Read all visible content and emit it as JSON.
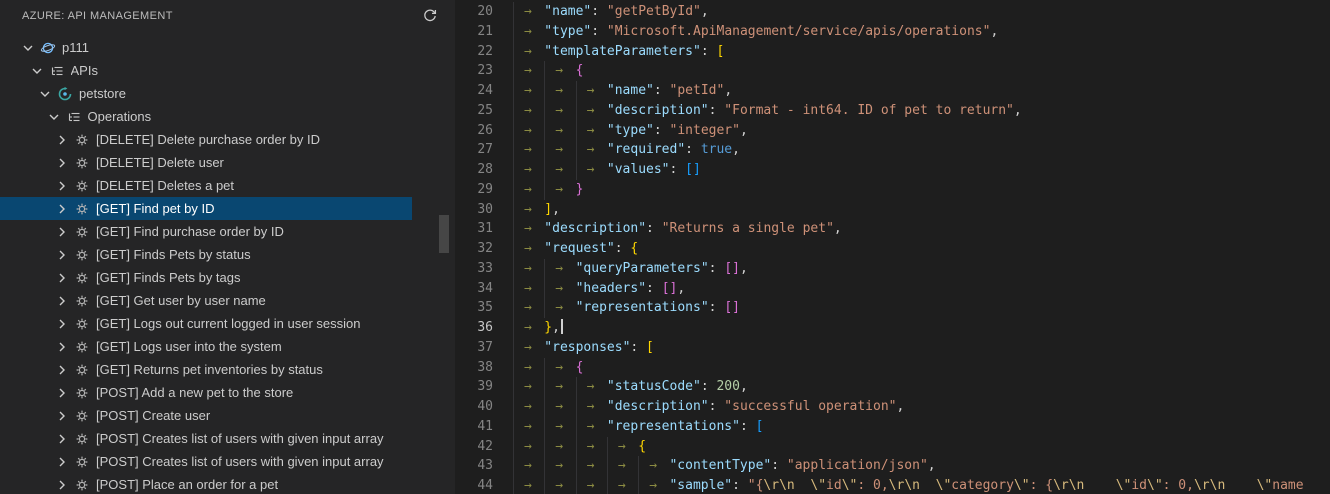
{
  "sidebar": {
    "title": "AZURE: API MANAGEMENT",
    "tree": [
      {
        "label": "p111",
        "level": 0,
        "expanded": true,
        "icon": "apim-service",
        "selected": false
      },
      {
        "label": "APIs",
        "level": 1,
        "expanded": true,
        "icon": "list-tree",
        "selected": false
      },
      {
        "label": "petstore",
        "level": 2,
        "expanded": true,
        "icon": "api",
        "selected": false
      },
      {
        "label": "Operations",
        "level": 3,
        "expanded": true,
        "icon": "list-tree",
        "selected": false
      },
      {
        "label": "[DELETE] Delete purchase order by ID",
        "level": 4,
        "expanded": false,
        "icon": "operation",
        "selected": false
      },
      {
        "label": "[DELETE] Delete user",
        "level": 4,
        "expanded": false,
        "icon": "operation",
        "selected": false
      },
      {
        "label": "[DELETE] Deletes a pet",
        "level": 4,
        "expanded": false,
        "icon": "operation",
        "selected": false
      },
      {
        "label": "[GET] Find pet by ID",
        "level": 4,
        "expanded": false,
        "icon": "operation",
        "selected": true
      },
      {
        "label": "[GET] Find purchase order by ID",
        "level": 4,
        "expanded": false,
        "icon": "operation",
        "selected": false
      },
      {
        "label": "[GET] Finds Pets by status",
        "level": 4,
        "expanded": false,
        "icon": "operation",
        "selected": false
      },
      {
        "label": "[GET] Finds Pets by tags",
        "level": 4,
        "expanded": false,
        "icon": "operation",
        "selected": false
      },
      {
        "label": "[GET] Get user by user name",
        "level": 4,
        "expanded": false,
        "icon": "operation",
        "selected": false
      },
      {
        "label": "[GET] Logs out current logged in user session",
        "level": 4,
        "expanded": false,
        "icon": "operation",
        "selected": false
      },
      {
        "label": "[GET] Logs user into the system",
        "level": 4,
        "expanded": false,
        "icon": "operation",
        "selected": false
      },
      {
        "label": "[GET] Returns pet inventories by status",
        "level": 4,
        "expanded": false,
        "icon": "operation",
        "selected": false
      },
      {
        "label": "[POST] Add a new pet to the store",
        "level": 4,
        "expanded": false,
        "icon": "operation",
        "selected": false
      },
      {
        "label": "[POST] Create user",
        "level": 4,
        "expanded": false,
        "icon": "operation",
        "selected": false
      },
      {
        "label": "[POST] Creates list of users with given input array",
        "level": 4,
        "expanded": false,
        "icon": "operation",
        "selected": false
      },
      {
        "label": "[POST] Creates list of users with given input array",
        "level": 4,
        "expanded": false,
        "icon": "operation",
        "selected": false
      },
      {
        "label": "[POST] Place an order for a pet",
        "level": 4,
        "expanded": false,
        "icon": "operation",
        "selected": false
      }
    ]
  },
  "editor": {
    "active_line": 36,
    "lines": [
      {
        "num": 20,
        "tokens": [
          [
            "tab"
          ],
          [
            "key",
            "\"name\""
          ],
          [
            "punc",
            ": "
          ],
          [
            "str",
            "\"getPetById\""
          ],
          [
            "punc",
            ","
          ]
        ]
      },
      {
        "num": 21,
        "tokens": [
          [
            "tab"
          ],
          [
            "key",
            "\"type\""
          ],
          [
            "punc",
            ": "
          ],
          [
            "str",
            "\"Microsoft.ApiManagement/service/apis/operations\""
          ],
          [
            "punc",
            ","
          ]
        ]
      },
      {
        "num": 22,
        "tokens": [
          [
            "tab"
          ],
          [
            "key",
            "\"templateParameters\""
          ],
          [
            "punc",
            ": "
          ],
          [
            "b1",
            "["
          ]
        ]
      },
      {
        "num": 23,
        "tokens": [
          [
            "tab"
          ],
          [
            "tab"
          ],
          [
            "b2",
            "{"
          ]
        ]
      },
      {
        "num": 24,
        "tokens": [
          [
            "tab"
          ],
          [
            "tab"
          ],
          [
            "tab"
          ],
          [
            "key",
            "\"name\""
          ],
          [
            "punc",
            ": "
          ],
          [
            "str",
            "\"petId\""
          ],
          [
            "punc",
            ","
          ]
        ]
      },
      {
        "num": 25,
        "tokens": [
          [
            "tab"
          ],
          [
            "tab"
          ],
          [
            "tab"
          ],
          [
            "key",
            "\"description\""
          ],
          [
            "punc",
            ": "
          ],
          [
            "str",
            "\"Format - int64. ID of pet to return\""
          ],
          [
            "punc",
            ","
          ]
        ]
      },
      {
        "num": 26,
        "tokens": [
          [
            "tab"
          ],
          [
            "tab"
          ],
          [
            "tab"
          ],
          [
            "key",
            "\"type\""
          ],
          [
            "punc",
            ": "
          ],
          [
            "str",
            "\"integer\""
          ],
          [
            "punc",
            ","
          ]
        ]
      },
      {
        "num": 27,
        "tokens": [
          [
            "tab"
          ],
          [
            "tab"
          ],
          [
            "tab"
          ],
          [
            "key",
            "\"required\""
          ],
          [
            "punc",
            ": "
          ],
          [
            "bool",
            "true"
          ],
          [
            "punc",
            ","
          ]
        ]
      },
      {
        "num": 28,
        "tokens": [
          [
            "tab"
          ],
          [
            "tab"
          ],
          [
            "tab"
          ],
          [
            "key",
            "\"values\""
          ],
          [
            "punc",
            ": "
          ],
          [
            "b3",
            "[]"
          ]
        ]
      },
      {
        "num": 29,
        "tokens": [
          [
            "tab"
          ],
          [
            "tab"
          ],
          [
            "b2",
            "}"
          ]
        ]
      },
      {
        "num": 30,
        "tokens": [
          [
            "tab"
          ],
          [
            "b1",
            "]"
          ],
          [
            "punc",
            ","
          ]
        ]
      },
      {
        "num": 31,
        "tokens": [
          [
            "tab"
          ],
          [
            "key",
            "\"description\""
          ],
          [
            "punc",
            ": "
          ],
          [
            "str",
            "\"Returns a single pet\""
          ],
          [
            "punc",
            ","
          ]
        ]
      },
      {
        "num": 32,
        "tokens": [
          [
            "tab"
          ],
          [
            "key",
            "\"request\""
          ],
          [
            "punc",
            ": "
          ],
          [
            "b1",
            "{"
          ]
        ]
      },
      {
        "num": 33,
        "tokens": [
          [
            "tab"
          ],
          [
            "tab"
          ],
          [
            "key",
            "\"queryParameters\""
          ],
          [
            "punc",
            ": "
          ],
          [
            "b2",
            "[]"
          ],
          [
            "punc",
            ","
          ]
        ]
      },
      {
        "num": 34,
        "tokens": [
          [
            "tab"
          ],
          [
            "tab"
          ],
          [
            "key",
            "\"headers\""
          ],
          [
            "punc",
            ": "
          ],
          [
            "b2",
            "[]"
          ],
          [
            "punc",
            ","
          ]
        ]
      },
      {
        "num": 35,
        "tokens": [
          [
            "tab"
          ],
          [
            "tab"
          ],
          [
            "key",
            "\"representations\""
          ],
          [
            "punc",
            ": "
          ],
          [
            "b2",
            "[]"
          ]
        ]
      },
      {
        "num": 36,
        "tokens": [
          [
            "tab"
          ],
          [
            "b1",
            "}"
          ],
          [
            "punc",
            ","
          ],
          [
            "cursor"
          ]
        ]
      },
      {
        "num": 37,
        "tokens": [
          [
            "tab"
          ],
          [
            "key",
            "\"responses\""
          ],
          [
            "punc",
            ": "
          ],
          [
            "b1",
            "["
          ]
        ]
      },
      {
        "num": 38,
        "tokens": [
          [
            "tab"
          ],
          [
            "tab"
          ],
          [
            "b2",
            "{"
          ]
        ]
      },
      {
        "num": 39,
        "tokens": [
          [
            "tab"
          ],
          [
            "tab"
          ],
          [
            "tab"
          ],
          [
            "key",
            "\"statusCode\""
          ],
          [
            "punc",
            ": "
          ],
          [
            "num",
            "200"
          ],
          [
            "punc",
            ","
          ]
        ]
      },
      {
        "num": 40,
        "tokens": [
          [
            "tab"
          ],
          [
            "tab"
          ],
          [
            "tab"
          ],
          [
            "key",
            "\"description\""
          ],
          [
            "punc",
            ": "
          ],
          [
            "str",
            "\"successful operation\""
          ],
          [
            "punc",
            ","
          ]
        ]
      },
      {
        "num": 41,
        "tokens": [
          [
            "tab"
          ],
          [
            "tab"
          ],
          [
            "tab"
          ],
          [
            "key",
            "\"representations\""
          ],
          [
            "punc",
            ": "
          ],
          [
            "b3",
            "["
          ]
        ]
      },
      {
        "num": 42,
        "tokens": [
          [
            "tab"
          ],
          [
            "tab"
          ],
          [
            "tab"
          ],
          [
            "tab"
          ],
          [
            "b1",
            "{"
          ]
        ]
      },
      {
        "num": 43,
        "tokens": [
          [
            "tab"
          ],
          [
            "tab"
          ],
          [
            "tab"
          ],
          [
            "tab"
          ],
          [
            "tab"
          ],
          [
            "key",
            "\"contentType\""
          ],
          [
            "punc",
            ": "
          ],
          [
            "str",
            "\"application/json\""
          ],
          [
            "punc",
            ","
          ]
        ]
      },
      {
        "num": 44,
        "tokens": [
          [
            "tab"
          ],
          [
            "tab"
          ],
          [
            "tab"
          ],
          [
            "tab"
          ],
          [
            "tab"
          ],
          [
            "key",
            "\"sample\""
          ],
          [
            "punc",
            ": "
          ],
          [
            "str",
            "\"{"
          ],
          [
            "esc",
            "\\r\\n"
          ],
          [
            "str",
            "  "
          ],
          [
            "esc",
            "\\\""
          ],
          [
            "str",
            "id"
          ],
          [
            "esc",
            "\\\""
          ],
          [
            "str",
            ": 0,"
          ],
          [
            "esc",
            "\\r\\n"
          ],
          [
            "str",
            "  "
          ],
          [
            "esc",
            "\\\""
          ],
          [
            "str",
            "category"
          ],
          [
            "esc",
            "\\\""
          ],
          [
            "str",
            ": {"
          ],
          [
            "esc",
            "\\r\\n"
          ],
          [
            "str",
            "    "
          ],
          [
            "esc",
            "\\\""
          ],
          [
            "str",
            "id"
          ],
          [
            "esc",
            "\\\""
          ],
          [
            "str",
            ": 0,"
          ],
          [
            "esc",
            "\\r\\n"
          ],
          [
            "str",
            "    "
          ],
          [
            "esc",
            "\\\""
          ],
          [
            "str",
            "name"
          ]
        ]
      }
    ]
  },
  "colors": {
    "editor_bg": "#1e1e1e",
    "sidebar_bg": "#252526",
    "selection_bg": "#094771",
    "key": "#9cdcfe",
    "string": "#ce9178",
    "escape": "#d7ba7d",
    "number": "#b5cea8",
    "keyword": "#569cd6",
    "punctuation": "#d4d4d4",
    "bracket_gold": "#ffd700",
    "bracket_pink": "#da70d6",
    "bracket_blue": "#179fff",
    "line_number": "#858585",
    "line_number_active": "#c6c6c6",
    "tab_arrow": "#8b8b42"
  }
}
